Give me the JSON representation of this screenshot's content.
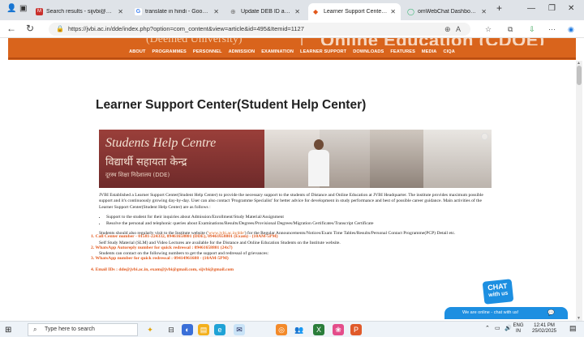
{
  "browser": {
    "tabs": [
      {
        "title": "Search results - sijvbi@gmai",
        "favicon_color": "#c9302c",
        "favicon": "M"
      },
      {
        "title": "translate in hindi - Google S",
        "favicon_color": "#4285f4",
        "favicon": "G"
      },
      {
        "title": "Update DEB ID and ABC ID",
        "favicon_color": "#777777",
        "favicon": "⊕"
      },
      {
        "title": "Learner Support Center(Stu",
        "favicon_color": "#e2571b",
        "favicon": "◆"
      },
      {
        "title": "omWebChat Dashboard",
        "favicon_color": "#2fb36d",
        "favicon": "◯"
      }
    ],
    "active_tab_index": 3,
    "new_tab": "+",
    "url": "https://jvbi.ac.in/dde/index.php?option=com_content&view=article&id=495&Itemid=1127"
  },
  "site": {
    "deemed_text": "(Deemed University)",
    "separator": "|",
    "header_title": "Online Education (CDOE)",
    "menu": [
      "ABOUT",
      "PROGRAMMES",
      "PERSONNEL",
      "ADMISSION",
      "EXAMINATION",
      "LEARNER SUPPORT",
      "DOWNLOADS",
      "FEATURES",
      "MEDIA",
      "CIQA"
    ]
  },
  "main": {
    "page_title": "Learner Support Center(Student Help Center)",
    "banner": {
      "sign_english": "Students Help Centre",
      "sign_hindi": "विद्यार्थी सहायता केन्द्र",
      "sign_sub": "दूरस्थ शिक्षा निदेशालय (DDE)"
    },
    "intro": "JVBI Established a Learner Support Center(Student Help Center) to provide the necessary support to the students of Distance and Online Education at JVBI Headquarter. The institute provides maximum possible support and it's continuously growing day-by-day. User can also contact 'Programme Specialist' for better advice for development in study performance and best of possible career guidance. Main activities of the Learner Support Center(Student Help Center) are as follows :",
    "bullets": [
      "Support to the student for their inquiries about Admission/Enrollment/Study Material/Assignment",
      "Resolve the personal and telephonic queries about Examinations/Results/Degrees/Provisional Degrees/Migration Certificates/Transcript Certificate"
    ],
    "visit_prefix": "Students should also regularly visit to the Institute website (",
    "visit_link": "'www.jvbi.ac.in/dde'",
    "visit_suffix": ") for the Regular Announcements/Notices/Exam Time Tables/Results/Personal Contact Programme(PCP) Detail etc.",
    "slm_note": "Self Study Material (SLM) and Video Lectures are available for the Distance and Online Education Students on the Institute website.",
    "contact_intro": "Students can contact on the following numbers to get the support and redressal of grievances:",
    "contacts": [
      "1. Call Center number - 01581-224332, 09461658801 (DDE), 09461658801 (Exam) - (10AM-5PM)",
      "2. WhatsApp Autoreply number for quick redressal : 09461658801 (24x7)",
      "3. WhatsApp number for quick redressal : 09414961688 - (10AM-5PM)",
      "4. Email IDs : dde@jvbi.ac.in, exam@jvbi@gmail.com, sijvbi@gmail.com"
    ]
  },
  "chat": {
    "badge_line1": "CHAT",
    "badge_line2": "with us",
    "bar_text": "We are online - chat with us!"
  },
  "taskbar": {
    "search_placeholder": "Type here to search",
    "language": "ENG",
    "region": "IN",
    "time": "12:41 PM",
    "date": "25/02/2025"
  }
}
